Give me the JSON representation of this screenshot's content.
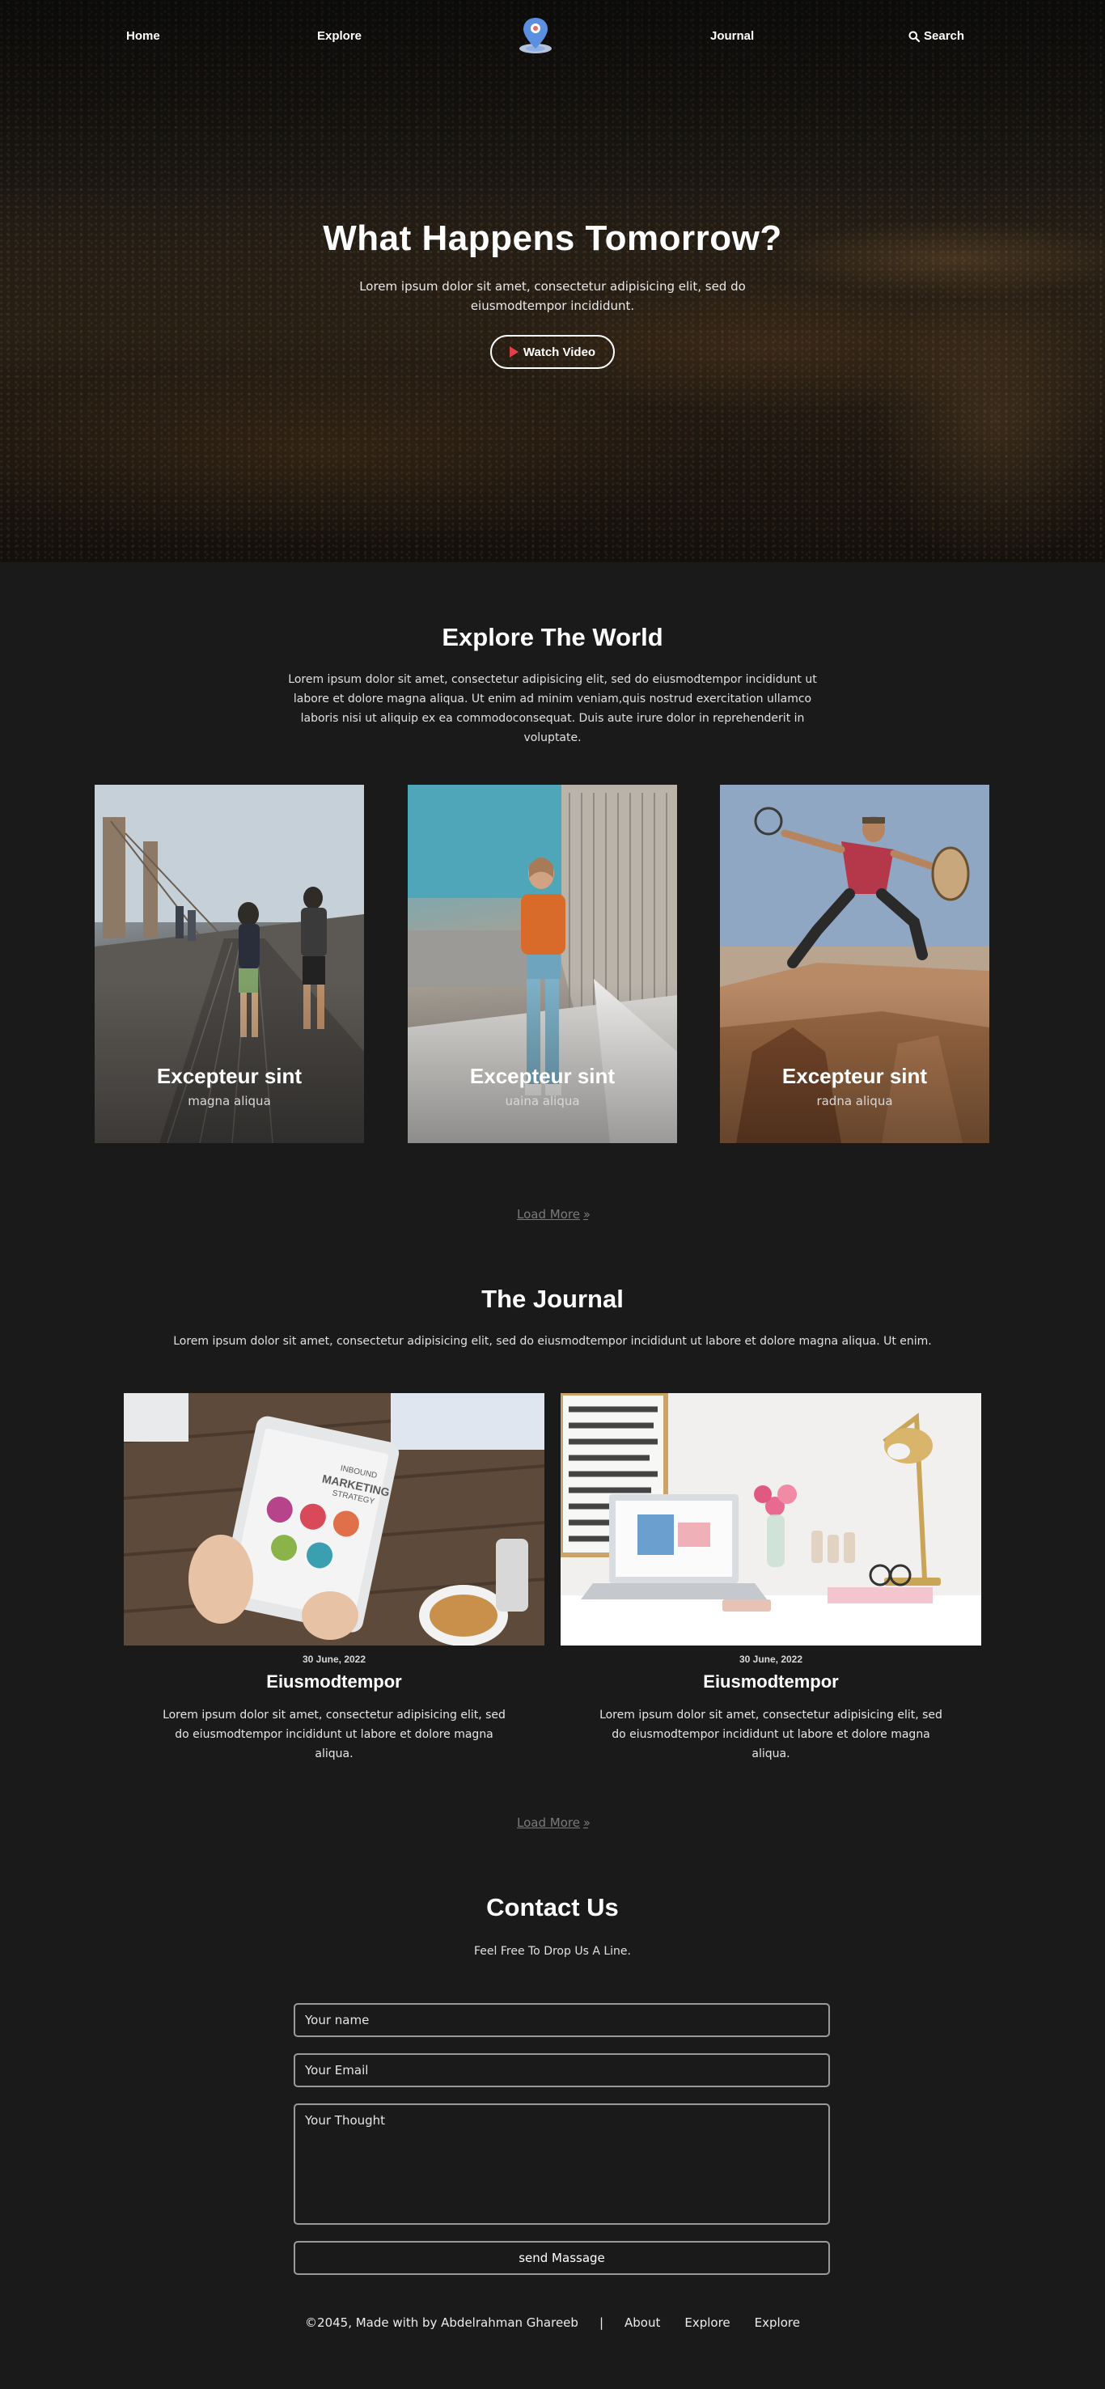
{
  "nav": {
    "home": "Home",
    "explore": "Explore",
    "journal": "Journal",
    "search": "Search",
    "logo_icon": "map-pin-icon",
    "search_icon": "search-icon"
  },
  "hero": {
    "title": "What Happens Tomorrow?",
    "subtitle": "Lorem ipsum dolor sit amet, consectetur adipisicing elit, sed do eiusmodtempor incididunt.",
    "button_label": "Watch Video",
    "button_icon": "play-icon"
  },
  "explore": {
    "title": "Explore The World",
    "text": "Lorem ipsum dolor sit amet, consectetur adipisicing elit, sed do eiusmodtempor incididunt ut labore et dolore magna aliqua. Ut enim ad minim veniam,quis nostrud exercitation ullamco laboris nisi ut aliquip ex ea commodoconsequat. Duis aute irure dolor in reprehenderit in voluptate.",
    "cards": [
      {
        "title": "Excepteur sint",
        "subtitle": "magna aliqua"
      },
      {
        "title": "Excepteur sint",
        "subtitle": "uaina aliqua"
      },
      {
        "title": "Excepteur sint",
        "subtitle": "radna aliqua"
      }
    ],
    "load_more": "Load More"
  },
  "journal": {
    "title": "The Journal",
    "text": "Lorem ipsum dolor sit amet, consectetur adipisicing elit, sed do eiusmodtempor incididunt ut labore et dolore magna aliqua. Ut enim.",
    "posts": [
      {
        "date": "30 June, 2022",
        "title": "Eiusmodtempor",
        "text": "Lorem ipsum dolor sit amet, consectetur adipisicing elit, sed do eiusmodtempor incididunt ut labore et dolore magna aliqua.",
        "tablet_line1": "INBOUND",
        "tablet_line2": "MARKETING",
        "tablet_line3": "STRATEGY"
      },
      {
        "date": "30 June, 2022",
        "title": "Eiusmodtempor",
        "text": "Lorem ipsum dolor sit amet, consectetur adipisicing elit, sed do eiusmodtempor incididunt ut labore et dolore magna aliqua."
      }
    ],
    "load_more": "Load More"
  },
  "contact": {
    "title": "Contact Us",
    "subtitle": "Feel Free To Drop Us A Line.",
    "name_placeholder": "Your name",
    "email_placeholder": "Your Email",
    "thought_placeholder": "Your Thought",
    "submit_label": "send Massage"
  },
  "footer": {
    "copyright": "©2045, Made with by Abdelrahman Ghareeb",
    "separator": "|",
    "links": [
      "About",
      "Explore",
      "Explore"
    ]
  },
  "colors": {
    "background": "#1a1a1a",
    "text": "#ffffff",
    "muted": "#7a7a7a",
    "accent_play": "#e0404a",
    "logo_blue": "#5b8fe0"
  }
}
